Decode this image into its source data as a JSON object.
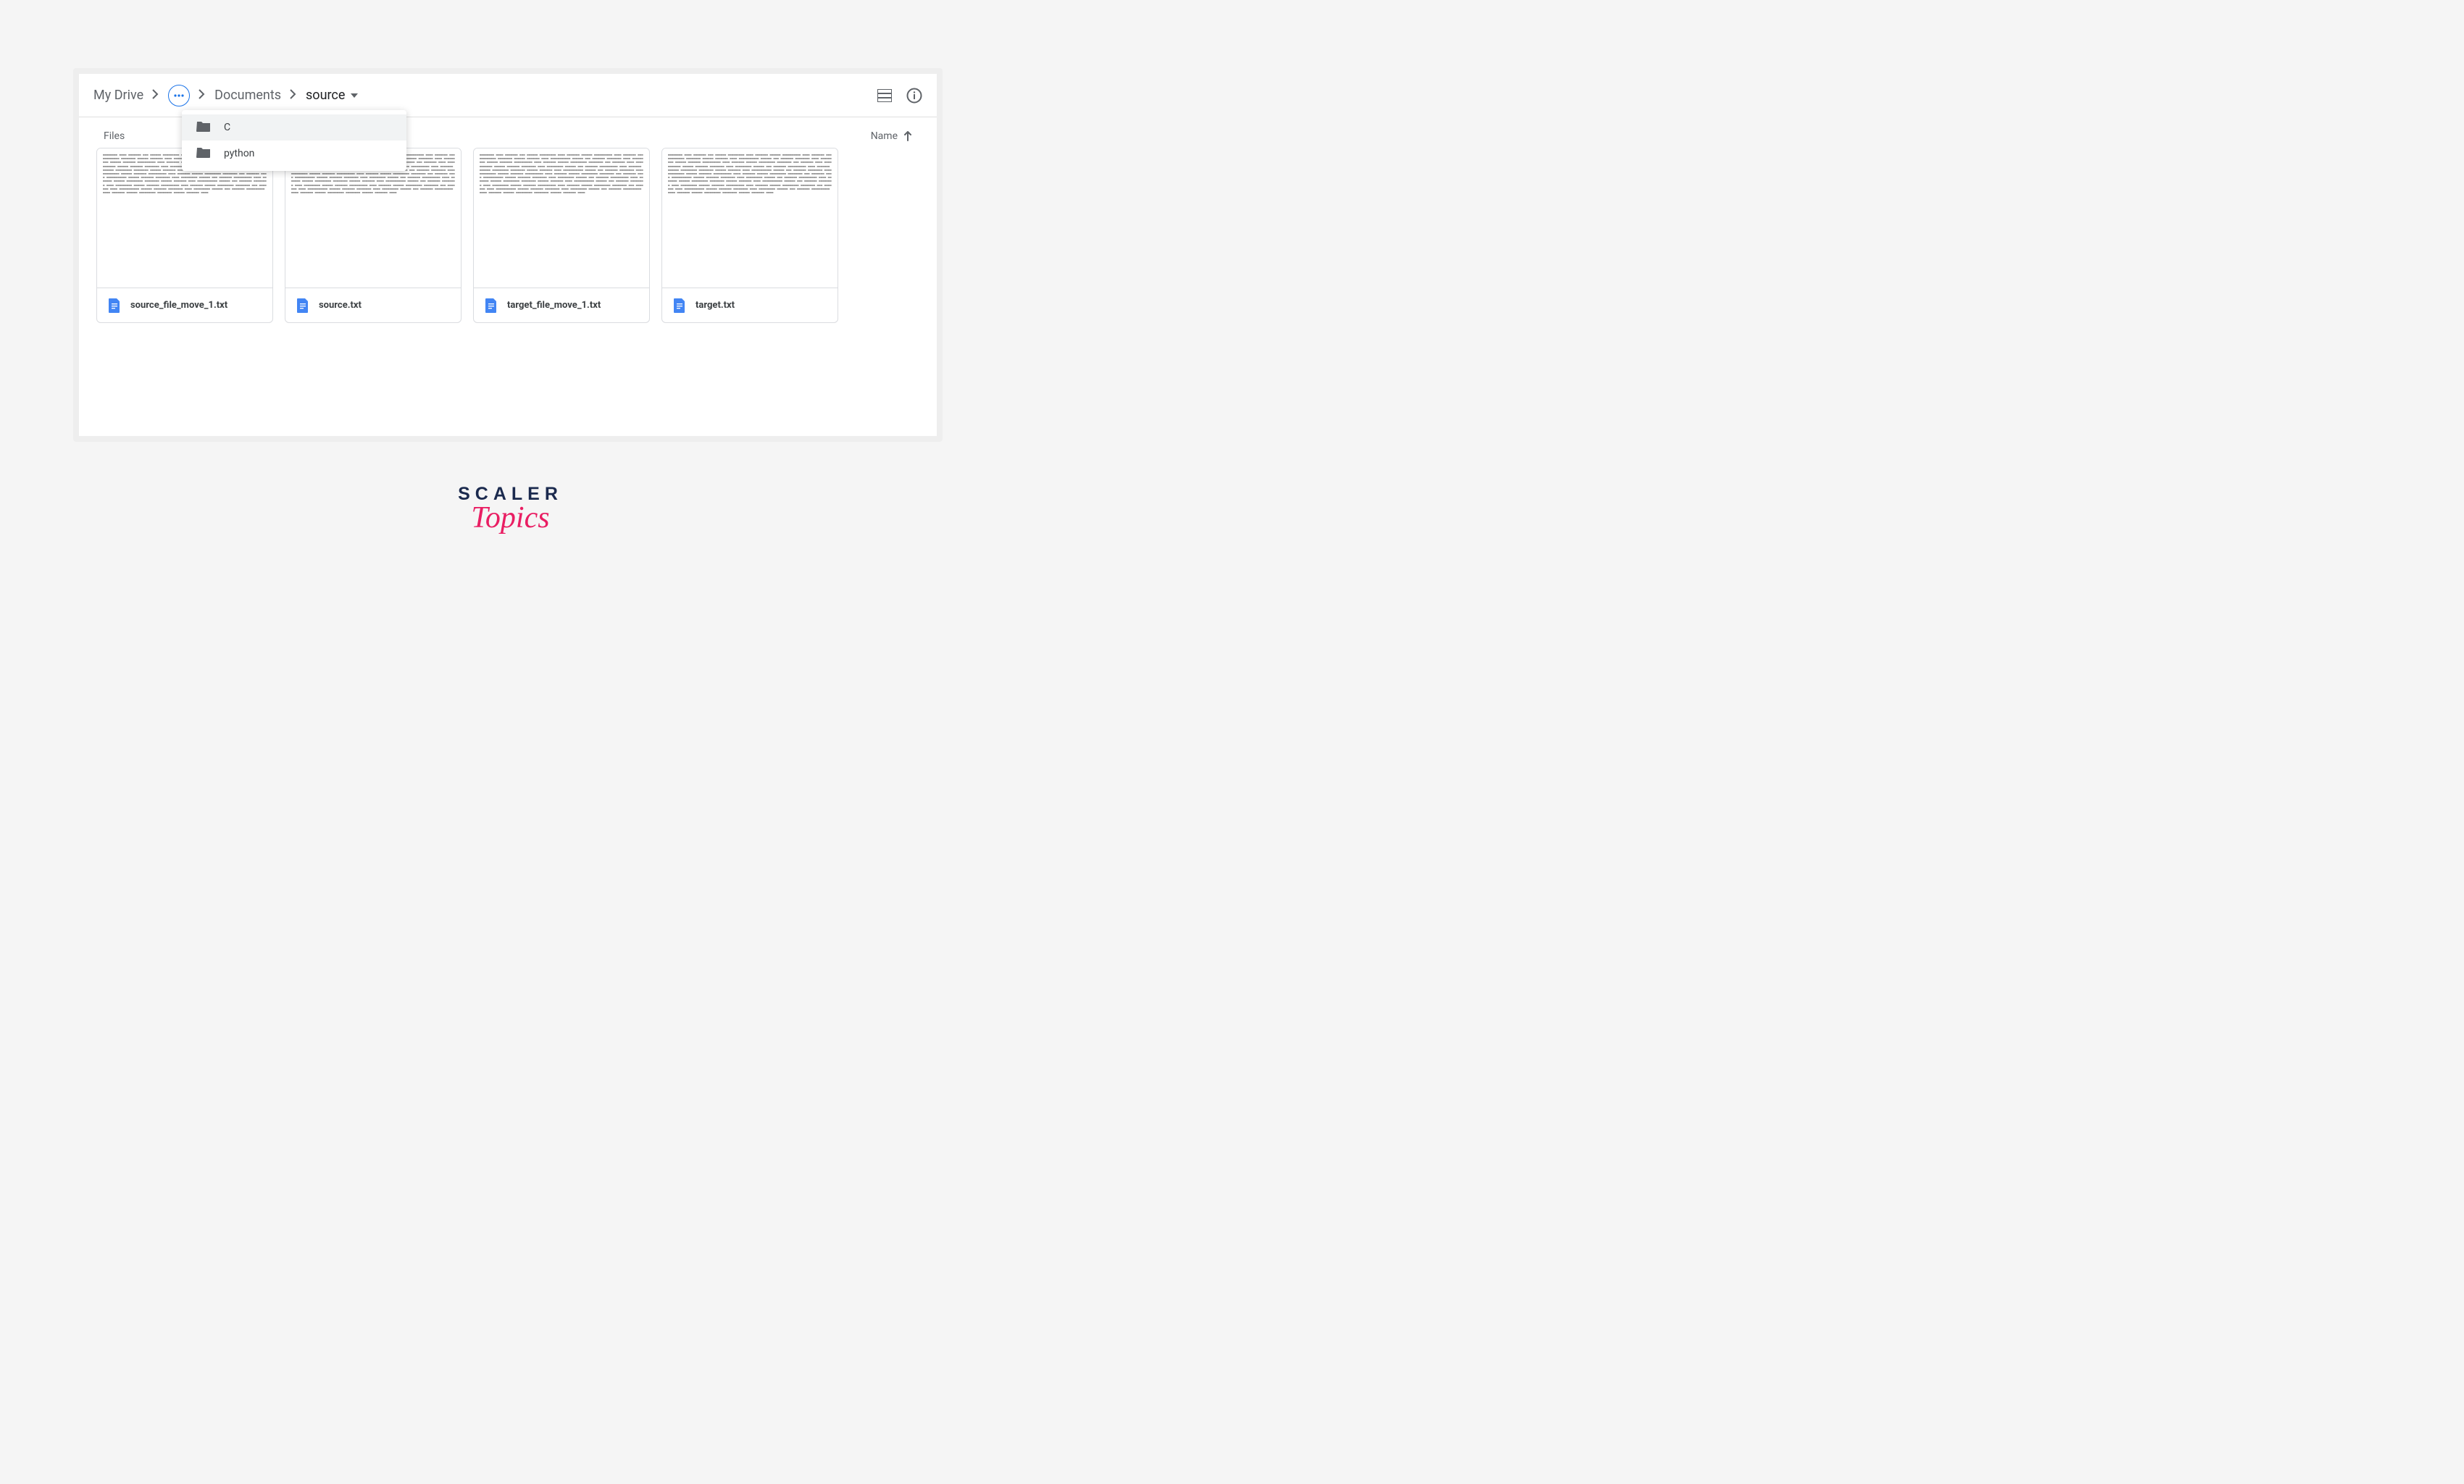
{
  "breadcrumb": {
    "root": "My Drive",
    "mid": "Documents",
    "current": "source"
  },
  "dropdown": {
    "items": [
      {
        "label": "C"
      },
      {
        "label": "python"
      }
    ]
  },
  "section": {
    "title": "Files",
    "sort_label": "Name"
  },
  "files": [
    {
      "name": "source_file_move_1.txt"
    },
    {
      "name": "source.txt"
    },
    {
      "name": "target_file_move_1.txt"
    },
    {
      "name": "target.txt"
    }
  ],
  "brand": {
    "line1": "SCALER",
    "line2": "Topics"
  }
}
